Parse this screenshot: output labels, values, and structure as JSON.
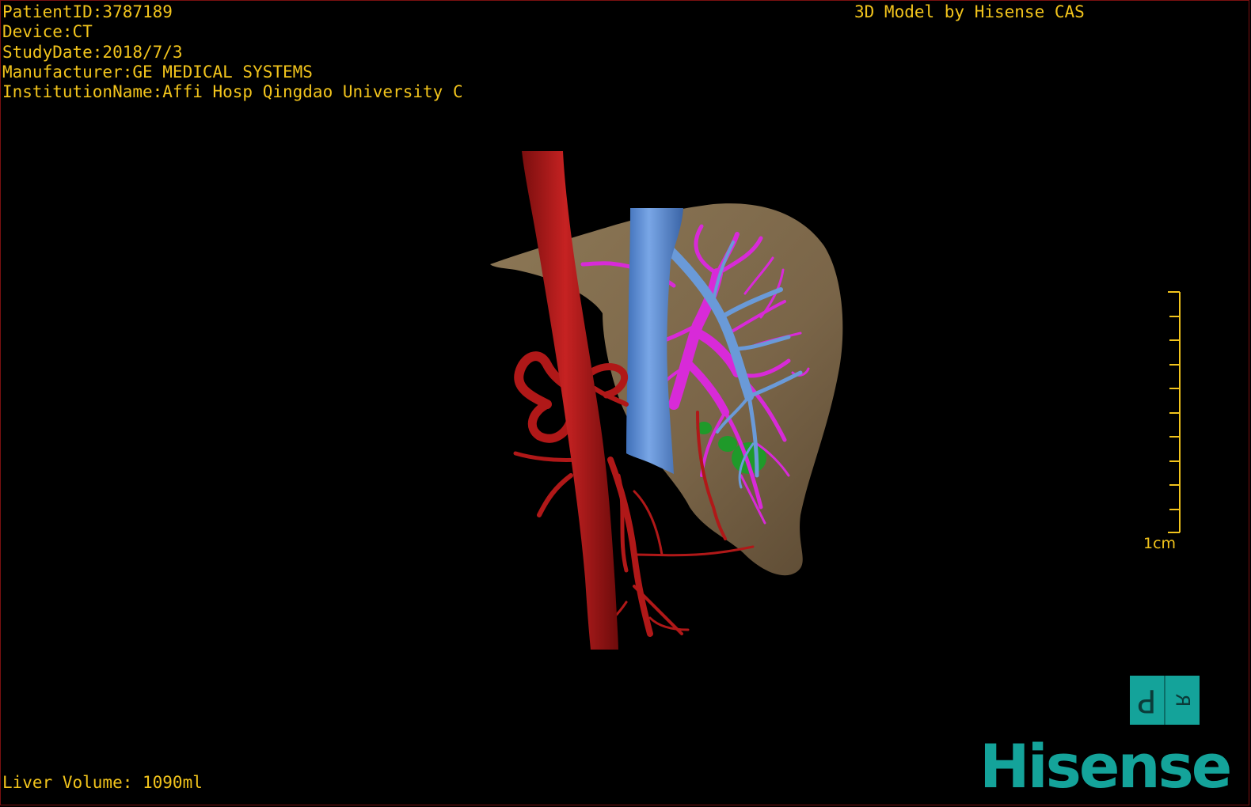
{
  "overlay": {
    "patient_id": "PatientID:3787189",
    "device": "Device:CT",
    "study_date": "StudyDate:2018/7/3",
    "manufacturer": "Manufacturer:GE MEDICAL SYSTEMS",
    "institution": "InstitutionName:Affi Hosp Qingdao University C",
    "credit": "3D Model by Hisense CAS",
    "liver_volume": "Liver Volume: 1090ml"
  },
  "scale_bar": {
    "label": "1cm"
  },
  "orientation_cube": {
    "left_letter": "P",
    "right_letter": "R"
  },
  "logo": {
    "text": "Hisense"
  },
  "colors": {
    "overlay_text": "#f2c41c",
    "liver": "#7e6a4c",
    "artery": "#b01818",
    "vena_cava": "#5b8fd6",
    "portal_vein": "#d82ad8",
    "lesion": "#1f9a2a",
    "brand": "#14a39a",
    "frame": "#7a1010"
  }
}
